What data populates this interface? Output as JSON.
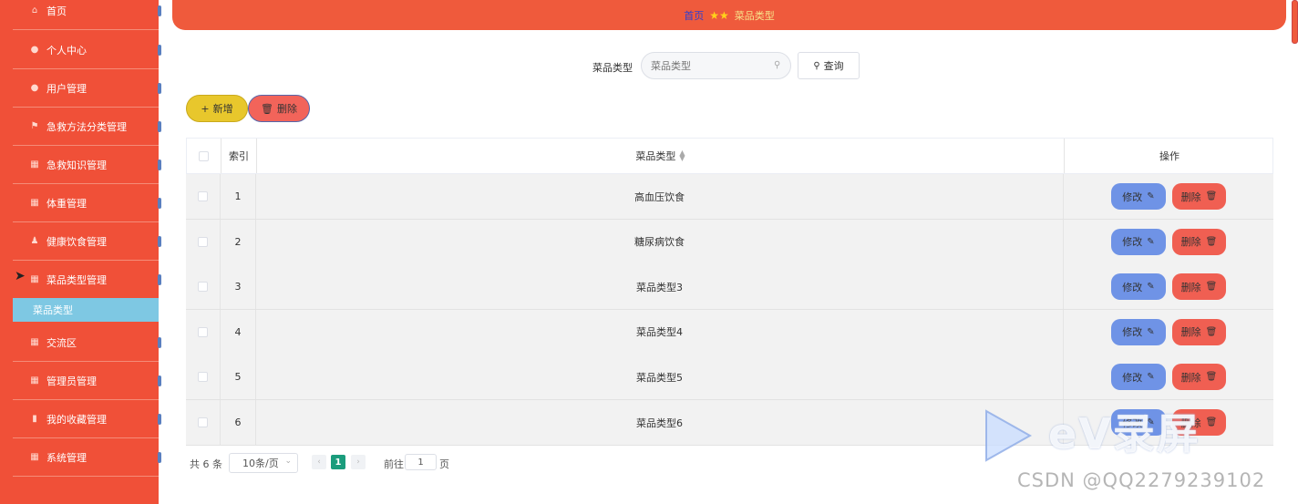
{
  "sidebar": {
    "items": [
      {
        "label": "首页",
        "icon": "home-icon"
      },
      {
        "label": "个人中心",
        "icon": "user-icon"
      },
      {
        "label": "用户管理",
        "icon": "user-icon"
      },
      {
        "label": "急救方法分类管理",
        "icon": "flag-icon"
      },
      {
        "label": "急救知识管理",
        "icon": "grid-icon"
      },
      {
        "label": "体重管理",
        "icon": "grid-icon"
      },
      {
        "label": "健康饮食管理",
        "icon": "person-icon"
      },
      {
        "label": "菜品类型管理",
        "icon": "grid-icon"
      },
      {
        "label": "交流区",
        "icon": "grid-icon"
      },
      {
        "label": "管理员管理",
        "icon": "grid-icon"
      },
      {
        "label": "我的收藏管理",
        "icon": "bar-chart-icon"
      },
      {
        "label": "系统管理",
        "icon": "grid-icon"
      }
    ],
    "submenu_label": "菜品类型",
    "colors": {
      "background": "#f05038",
      "submenu": "#7ec8e3"
    }
  },
  "breadcrumb": {
    "home": "首页",
    "current": "菜品类型"
  },
  "search": {
    "label": "菜品类型",
    "placeholder": "菜品类型",
    "button": "查询"
  },
  "actions": {
    "add": "新增",
    "delete": "删除"
  },
  "table": {
    "columns": {
      "index": "索引",
      "type": "菜品类型",
      "operation": "操作"
    },
    "rows": [
      {
        "index": "1",
        "type": "高血压饮食"
      },
      {
        "index": "2",
        "type": "糖尿病饮食"
      },
      {
        "index": "3",
        "type": "菜品类型3"
      },
      {
        "index": "4",
        "type": "菜品类型4"
      },
      {
        "index": "5",
        "type": "菜品类型5"
      },
      {
        "index": "6",
        "type": "菜品类型6"
      }
    ],
    "edit_label": "修改",
    "delete_label": "删除"
  },
  "pagination": {
    "total": "共 6 条",
    "page_size": "10条/页",
    "current_page": "1",
    "goto_label": "前往",
    "goto_value": "1",
    "page_unit": "页"
  },
  "watermark": {
    "ev_text": "eV录屏",
    "csdn": "CSDN @QQ2279239102"
  }
}
